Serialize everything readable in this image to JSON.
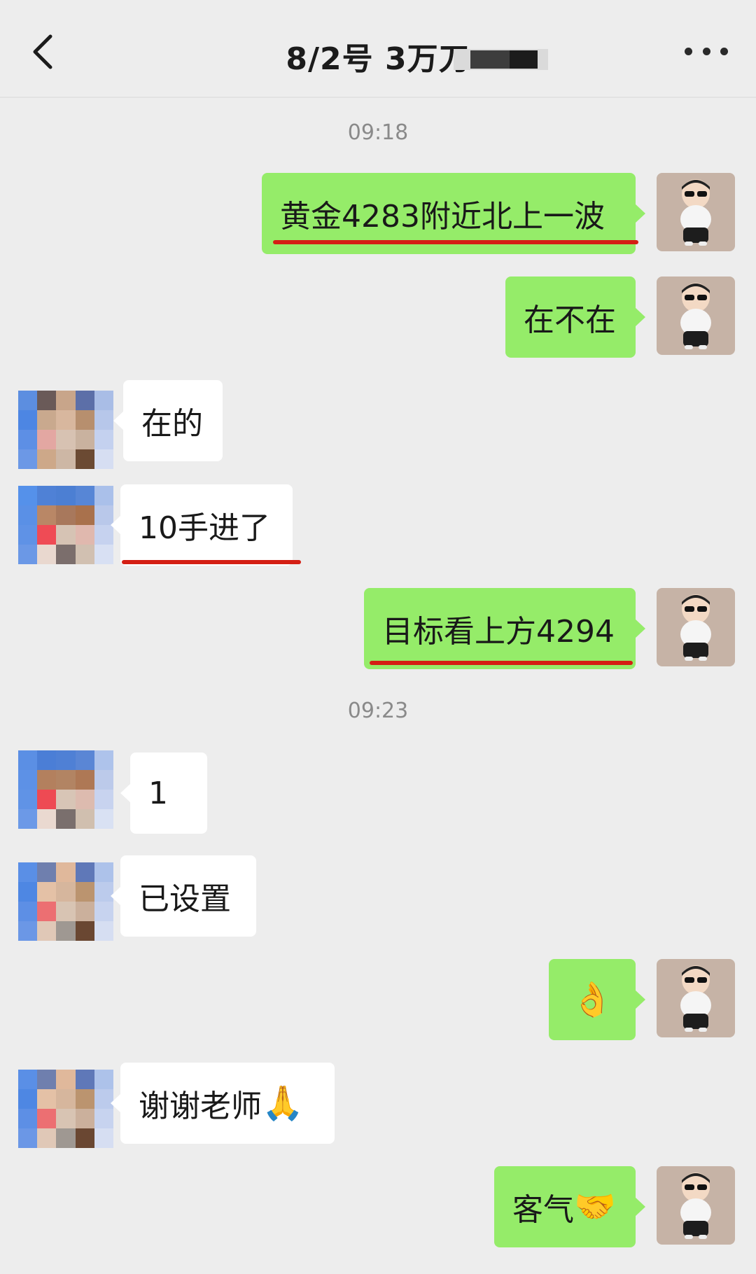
{
  "header": {
    "title": "8/2号  3万刀",
    "back_icon": "chevron-left-icon",
    "more_icon": "more-dots-icon"
  },
  "colors": {
    "sent_bubble": "#95ec69",
    "received_bubble": "#ffffff",
    "background": "#ededed",
    "highlight_underline": "#d41f14"
  },
  "messages": {
    "time1": "09:18",
    "m1": "黄金4283附近北上一波",
    "m2": "在不在",
    "m3": "在的",
    "m4": "10手进了",
    "m5": "目标看上方4294",
    "time2": "09:23",
    "m6": "1",
    "m7": "已设置",
    "m8_emoji": "👌",
    "m9": "谢谢老师",
    "m9_emoji": "🙏",
    "m10": "客气",
    "m10_emoji": "🤝"
  }
}
